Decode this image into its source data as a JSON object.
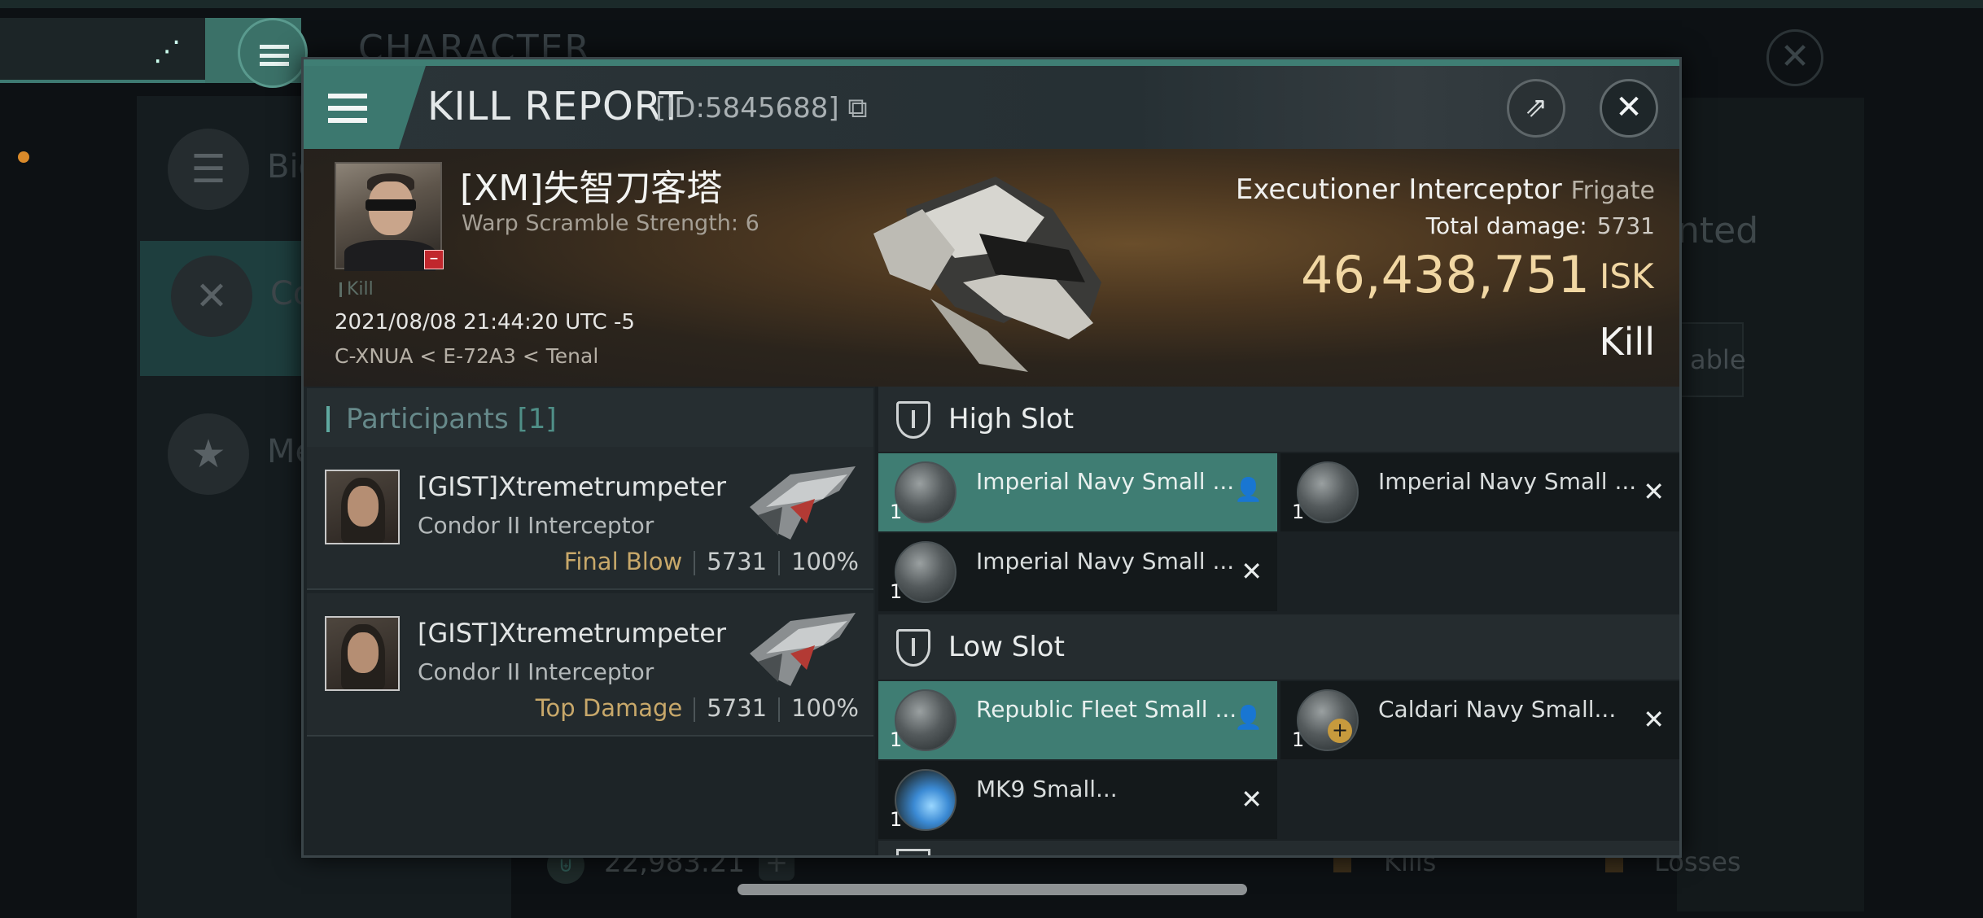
{
  "background": {
    "title": "CHARACTER",
    "side_items": [
      "Bio",
      "Co",
      "Me"
    ],
    "right_text": "nted",
    "right_button": "able",
    "footer": {
      "value": "22,983.21",
      "kills_label": "Kills",
      "losses_label": "Losses"
    }
  },
  "modal": {
    "title": "KILL REPORT",
    "id_text": "[ID:5845688]",
    "victim": {
      "name": "[XM]失智刀客塔",
      "warp_scramble": "Warp Scramble Strength: 6",
      "kill_tag": "Kill",
      "datetime": "2021/08/08 21:44:20 UTC -5",
      "location": "C-XNUA < E-72A3 < Tenal"
    },
    "ship": {
      "name": "Executioner Interceptor",
      "class": "Frigate",
      "total_damage_label": "Total damage:",
      "total_damage": "5731",
      "isk_value": "46,438,751",
      "isk_label": "ISK",
      "result": "Kill"
    },
    "participants": {
      "title": "Participants",
      "count": "[1]",
      "rows": [
        {
          "name": "[GIST]Xtremetrumpeter",
          "ship": "Condor II Interceptor",
          "label": "Final Blow",
          "damage": "5731",
          "percent": "100%"
        },
        {
          "name": "[GIST]Xtremetrumpeter",
          "ship": "Condor II Interceptor",
          "label": "Top Damage",
          "damage": "5731",
          "percent": "100%"
        }
      ]
    },
    "fittings": {
      "high_slot": {
        "title": "High Slot",
        "modules": [
          {
            "name": "Imperial Navy Small ...",
            "qty": "1",
            "status": "person-icon"
          },
          {
            "name": "Imperial Navy Small ...",
            "qty": "1",
            "status": "close-icon"
          },
          {
            "name": "Imperial Navy Small ...",
            "qty": "1",
            "status": "close-icon"
          }
        ]
      },
      "low_slot": {
        "title": "Low Slot",
        "modules": [
          {
            "name": "Republic Fleet Small ...",
            "qty": "1",
            "status": "person-icon"
          },
          {
            "name": "Caldari Navy Small...",
            "qty": "1",
            "status": "close-icon"
          },
          {
            "name": "MK9 Small...",
            "qty": "1",
            "status": "close-icon"
          }
        ]
      }
    }
  },
  "colors": {
    "accent": "#3f7d73",
    "isk": "#f1d7a3",
    "label_gold": "#c8a86a"
  }
}
